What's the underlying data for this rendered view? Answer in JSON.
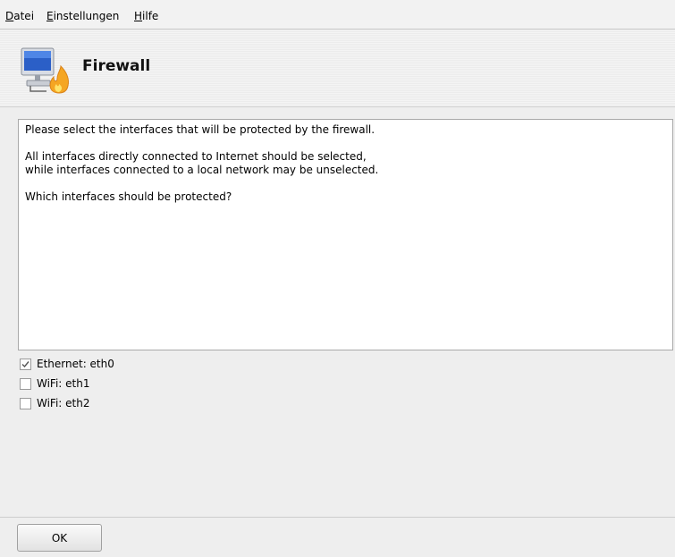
{
  "menubar": {
    "items": [
      {
        "mnemonic": "D",
        "rest": "atei"
      },
      {
        "mnemonic": "E",
        "rest": "instellungen"
      },
      {
        "mnemonic": "H",
        "rest": "ilfe"
      }
    ]
  },
  "header": {
    "title": "Firewall",
    "icon": "computer-with-flame-icon"
  },
  "message": {
    "line1": "Please select the interfaces that will be protected by the firewall.",
    "line2": "All interfaces directly connected to Internet should be selected,",
    "line3": "while interfaces connected to a local network may be unselected.",
    "line4": "Which interfaces should be protected?"
  },
  "interfaces": [
    {
      "label": "Ethernet: eth0",
      "checked": true
    },
    {
      "label": "WiFi: eth1",
      "checked": false
    },
    {
      "label": "WiFi: eth2",
      "checked": false
    }
  ],
  "buttons": {
    "ok_label": "OK"
  },
  "colors": {
    "window_bg": "#eeeeee",
    "text": "#000000",
    "flame": "#f5a623"
  }
}
